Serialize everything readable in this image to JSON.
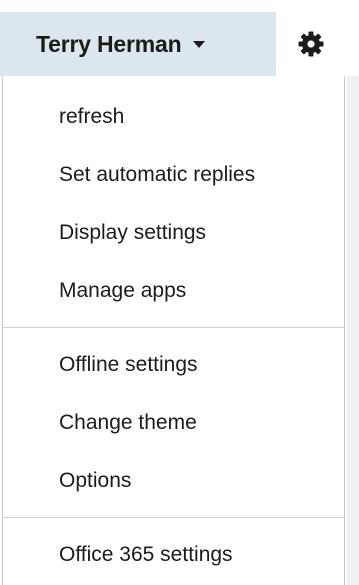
{
  "header": {
    "user_name": "Terry Herman",
    "dropdown_icon": "caret-down-icon",
    "settings_icon": "gear-icon"
  },
  "menu": {
    "groups": [
      {
        "items": [
          {
            "label": "refresh"
          },
          {
            "label": "Set automatic replies"
          },
          {
            "label": "Display settings"
          },
          {
            "label": "Manage apps"
          }
        ]
      },
      {
        "items": [
          {
            "label": "Offline settings"
          },
          {
            "label": "Change theme"
          },
          {
            "label": "Options"
          }
        ]
      },
      {
        "items": [
          {
            "label": "Office 365 settings"
          }
        ]
      }
    ]
  },
  "colors": {
    "header_bg": "#dce6ed",
    "text": "#1b1b1b",
    "divider": "#d0d0d0"
  }
}
